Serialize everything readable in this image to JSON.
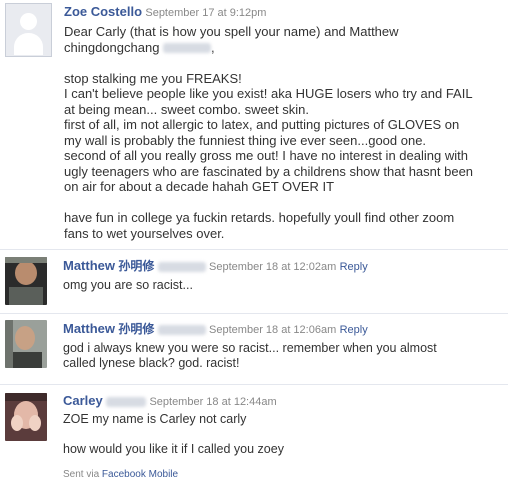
{
  "post": {
    "author": "Zoe Costello",
    "timestamp": "September 17 at 9:12pm",
    "body": "Dear Carly (that is how you spell your name) and Matthew\nchingdongchang",
    "body_tail": ",\n\nstop stalking me you FREAKS!\nI can't believe people like you exist! aka HUGE losers who try and FAIL\nat being mean... sweet combo. sweet skin.\nfirst of all, im not allergic to latex, and putting pictures of GLOVES on\nmy wall is probably the funniest thing ive ever seen...good one.\nsecond of all you really gross me out! I have no interest in dealing with\nugly teenagers who are fascinated by a childrens show that hasnt been\non air for about a decade hahah GET OVER IT\n\nhave fun in college ya fuckin retards. hopefully youll find other zoom\nfans to wet yourselves over."
  },
  "comments": [
    {
      "author": "Matthew",
      "author_cjk": "孙明修",
      "timestamp": "September 18 at 12:02am",
      "reply": "Reply",
      "text": "omg you are so racist..."
    },
    {
      "author": "Matthew",
      "author_cjk": "孙明修",
      "timestamp": "September 18 at 12:06am",
      "reply": "Reply",
      "text": "god i always knew you were so racist... remember when you almost\ncalled lynese black? god. racist!"
    },
    {
      "author": "Carley",
      "timestamp": "September 18 at 12:44am",
      "text": "ZOE my name is Carley not carly\n\nhow would you like it if I called you zoey",
      "sent_via_prefix": "Sent via",
      "sent_via_link": "Facebook Mobile"
    }
  ],
  "colors": {
    "link": "#3b5998",
    "meta": "#888888",
    "separator": "#e4e7ee"
  }
}
